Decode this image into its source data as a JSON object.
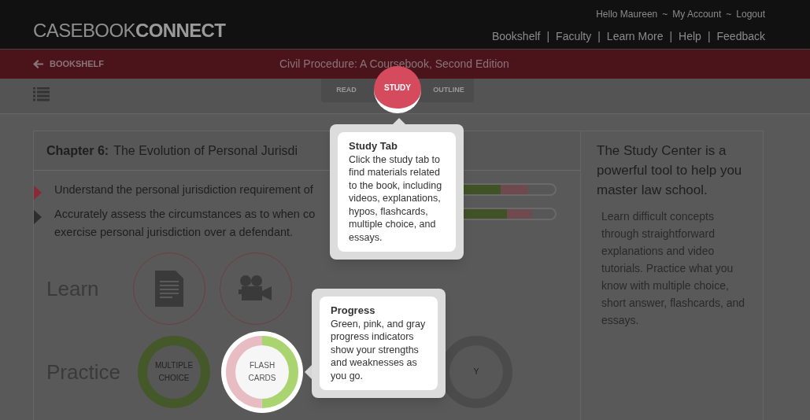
{
  "header": {
    "logo": {
      "light": "CASEBOOK",
      "bold": "CONNECT"
    },
    "account_links": [
      "Hello Maureen",
      "~",
      "My Account",
      "~",
      "Logout"
    ],
    "nav_links": [
      "Bookshelf",
      "|",
      "Faculty",
      "|",
      "Learn More",
      "|",
      "Help",
      "|",
      "Feedback"
    ]
  },
  "book_bar": {
    "back": "BOOKSHELF",
    "title": "Civil Procedure: A Coursebook, Second Edition"
  },
  "tabs": [
    {
      "label": "READ",
      "selected": false
    },
    {
      "label": "STUDY",
      "selected": true
    },
    {
      "label": "OUTLINE",
      "selected": false
    }
  ],
  "chapter": {
    "number": "Chapter 6:",
    "title": "The Evolution of Personal Jurisdi"
  },
  "objectives": [
    {
      "text": "Understand the personal jurisdiction requirement of",
      "selected": true,
      "progress": {
        "level": 0.5
      }
    },
    {
      "text": "Accurately assess the circumstances as to when co exercise personal jurisdiction over a defendant.",
      "selected": false,
      "progress": {
        "level": 0.56
      }
    }
  ],
  "learn": {
    "label": "Learn",
    "items": [
      {
        "kind": "document"
      },
      {
        "kind": "video"
      }
    ]
  },
  "practice": {
    "label": "Practice",
    "items": [
      {
        "label": "MULTIPLE CHOICE",
        "highlighted": false,
        "segments": [
          {
            "color": "#44582a"
          }
        ]
      },
      {
        "label": "FLASH CARDS",
        "highlighted": true,
        "segments": [
          {
            "color": "#a9d46f"
          },
          {
            "color": "#e8bcc3"
          }
        ]
      },
      {
        "label": "Y",
        "highlighted": false,
        "segments": [
          {
            "color": "#4b4b4b"
          }
        ]
      }
    ]
  },
  "sidebar": {
    "heading": "The Study Center is a powerful tool to help you master law school.",
    "body": "Learn difficult concepts through straightforward explanations and video tutorials. Practice what you know with multiple choice, short answer, flashcards, and essays."
  },
  "tooltips": [
    {
      "title": "Study Tab",
      "body": "Click the study tab to find materials related to the book, including videos, explanations, hypos, flashcards, multiple choice, and essays."
    },
    {
      "title": "Progress",
      "body": "Green, pink, and gray progress indicators show your strengths and weaknesses as you go."
    }
  ]
}
